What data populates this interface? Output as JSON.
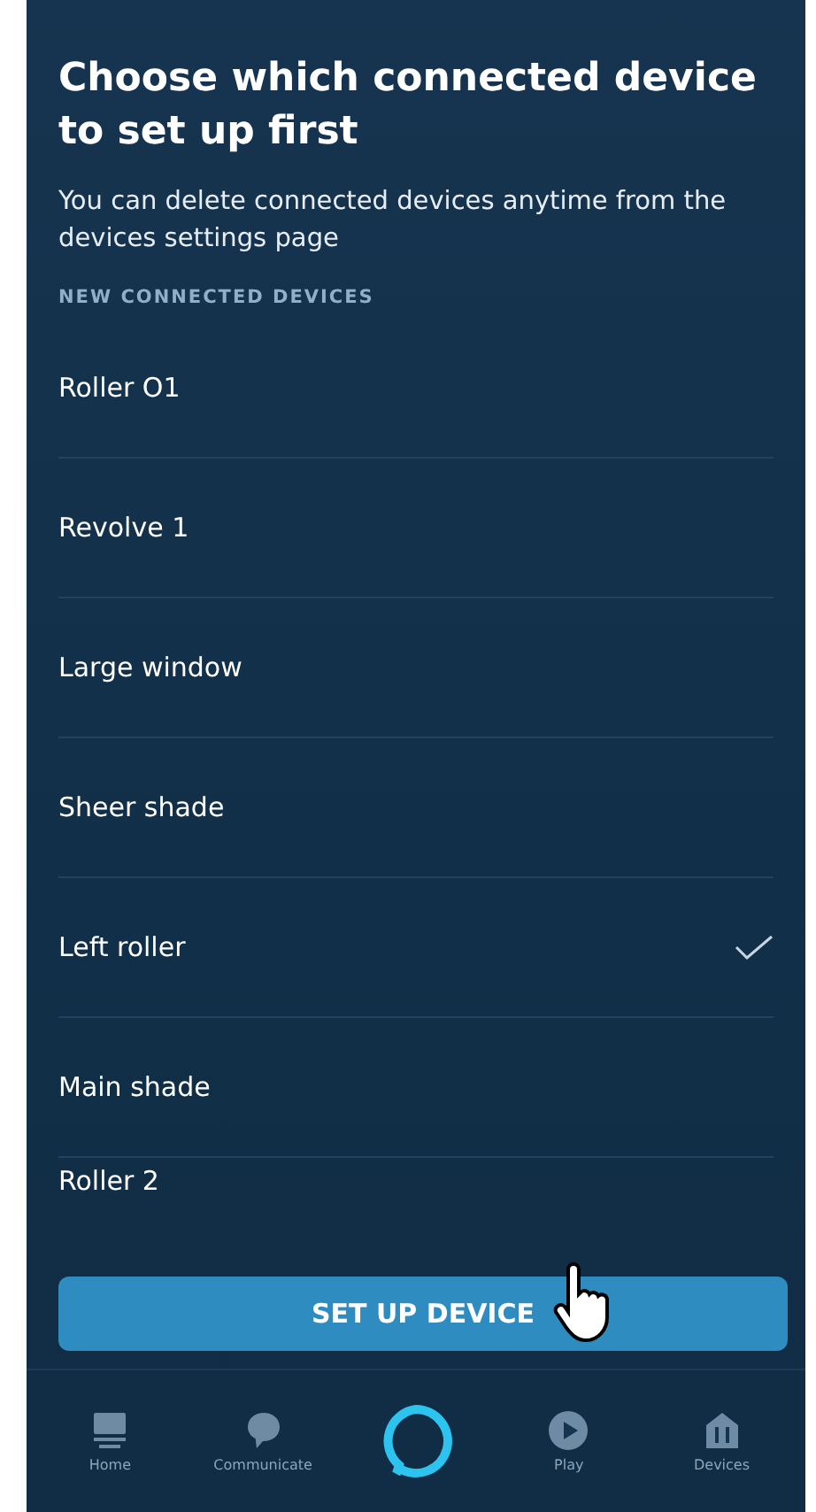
{
  "header": {
    "title": "Choose which connected device to set up first",
    "subtitle": "You can delete connected devices anytime from the devices settings page"
  },
  "section_label": "NEW CONNECTED DEVICES",
  "devices": [
    {
      "name": "Roller O1",
      "selected": false
    },
    {
      "name": "Revolve 1",
      "selected": false
    },
    {
      "name": "Large window",
      "selected": false
    },
    {
      "name": "Sheer shade",
      "selected": false
    },
    {
      "name": "Left roller",
      "selected": true
    },
    {
      "name": "Main shade",
      "selected": false
    },
    {
      "name": "Roller 2",
      "selected": false
    }
  ],
  "primary_button": "SET UP DEVICE",
  "nav": [
    {
      "kind": "home",
      "label": "Home"
    },
    {
      "kind": "communicate",
      "label": "Communicate"
    },
    {
      "kind": "alexa"
    },
    {
      "kind": "play",
      "label": "Play"
    },
    {
      "kind": "devices",
      "label": "Devices"
    }
  ]
}
